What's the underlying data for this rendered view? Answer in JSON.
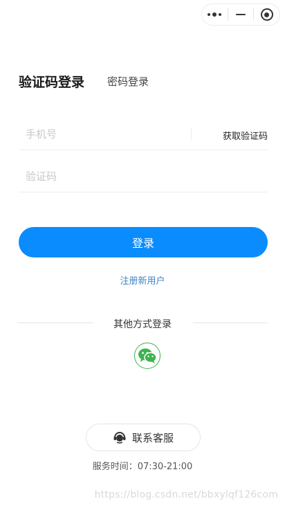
{
  "capsule": {
    "menu_icon": "more-dots-icon",
    "minimize_icon": "minimize-icon",
    "close_icon": "target-circle-icon"
  },
  "tabs": {
    "active": "验证码登录",
    "inactive": "密码登录"
  },
  "form": {
    "phone_placeholder": "手机号",
    "get_code": "获取验证码",
    "code_placeholder": "验证码"
  },
  "login_button": "登录",
  "register_link": "注册新用户",
  "other_login": {
    "label": "其他方式登录",
    "icon": "wechat-icon",
    "color": "#3fb34f"
  },
  "service": {
    "label": "联系客服",
    "icon": "headset-icon",
    "hours": "服务时间：07:30-21:00"
  },
  "watermark": "https://blog.csdn.net/bbxylqf126com",
  "colors": {
    "primary": "#0a8cff",
    "link": "#3b83c6"
  }
}
